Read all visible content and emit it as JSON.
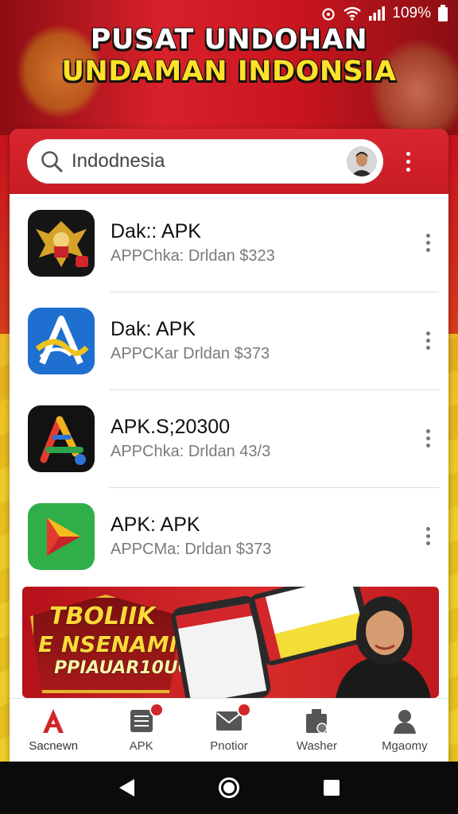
{
  "status_bar": {
    "battery": "109%"
  },
  "banner": {
    "line1": "PUSAT UNDOHAN",
    "line2": "UNDAMAN INDONSIA"
  },
  "search": {
    "value": "Indodnesia"
  },
  "apps": [
    {
      "name": "Dak:: APK",
      "subtitle": "APPChka: Drldan $323",
      "icon": "garuda-icon"
    },
    {
      "name": "Dak: APK",
      "subtitle": "APPCKar Drldan $373",
      "icon": "blue-a-logo-icon"
    },
    {
      "name": "APK.S;20300",
      "subtitle": "APPChka: Drldan 43/3",
      "icon": "rainbow-a-logo-icon"
    },
    {
      "name": "APK: APK",
      "subtitle": "APPCMa: Drldan $373",
      "icon": "play-triangle-icon"
    }
  ],
  "promo": {
    "line1": "TBOLIIK",
    "line2": "E NSENAMIO",
    "line3": "PPIAUAR10UOI"
  },
  "bottom_nav": [
    {
      "label": "Sacnewn",
      "icon": "a-logo-icon"
    },
    {
      "label": "APK",
      "icon": "apk-grid-icon",
      "badge": ""
    },
    {
      "label": "Pnotior",
      "icon": "mail-icon",
      "badge": ""
    },
    {
      "label": "Washer",
      "icon": "package-icon"
    },
    {
      "label": "Mgaomy",
      "icon": "profile-icon"
    }
  ],
  "colors": {
    "primary_red": "#d3262b",
    "banner_yellow": "#ffe12a"
  }
}
